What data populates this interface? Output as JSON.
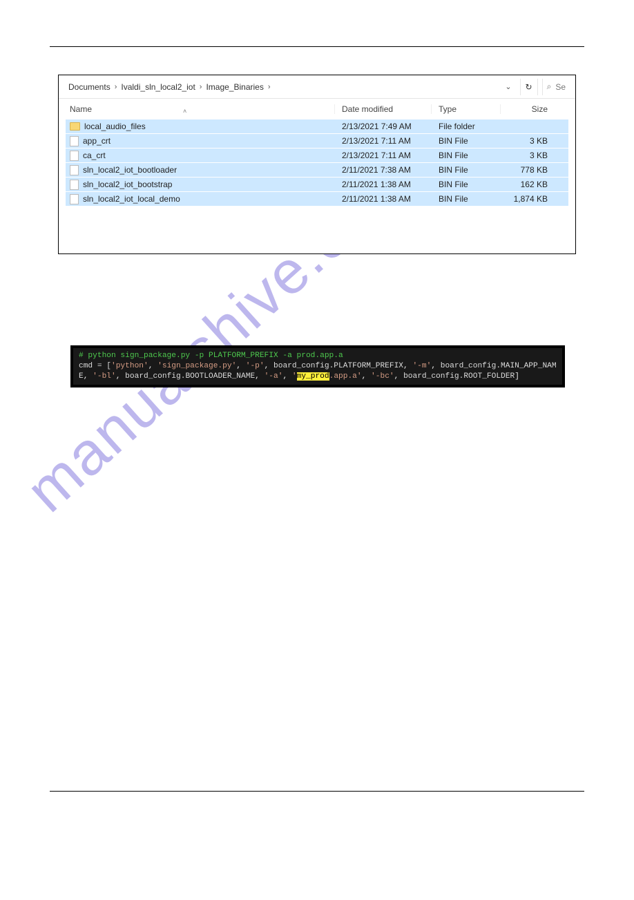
{
  "watermark": "manualshive.com",
  "explorer": {
    "breadcrumb": [
      "Documents",
      "Ivaldi_sln_local2_iot",
      "Image_Binaries"
    ],
    "search_placeholder": "Se",
    "columns": {
      "name": "Name",
      "date": "Date modified",
      "type": "Type",
      "size": "Size"
    },
    "rows": [
      {
        "kind": "folder",
        "name": "local_audio_files",
        "date": "2/13/2021 7:49 AM",
        "type": "File folder",
        "size": ""
      },
      {
        "kind": "file",
        "name": "app_crt",
        "date": "2/13/2021 7:11 AM",
        "type": "BIN File",
        "size": "3 KB"
      },
      {
        "kind": "file",
        "name": "ca_crt",
        "date": "2/13/2021 7:11 AM",
        "type": "BIN File",
        "size": "3 KB"
      },
      {
        "kind": "file",
        "name": "sln_local2_iot_bootloader",
        "date": "2/11/2021 7:38 AM",
        "type": "BIN File",
        "size": "778 KB"
      },
      {
        "kind": "file",
        "name": "sln_local2_iot_bootstrap",
        "date": "2/11/2021 1:38 AM",
        "type": "BIN File",
        "size": "162 KB"
      },
      {
        "kind": "file",
        "name": "sln_local2_iot_local_demo",
        "date": "2/11/2021 1:38 AM",
        "type": "BIN File",
        "size": "1,874 KB"
      }
    ]
  },
  "code": {
    "comment": "# python sign_package.py -p PLATFORM_PREFIX -a prod.app.a",
    "line2_pre": "cmd = [",
    "tokens": {
      "python": "'python'",
      "sign": "'sign_package.py'",
      "p": "'-p'",
      "platform": "board_config.PLATFORM_PREFIX",
      "m": "'-m'",
      "main": "board_config.MAIN_APP_NAME",
      "bl_flag": "'-bl'",
      "bootloader": "board_config.BOOTLOADER_NAME",
      "a": "'-a'",
      "hl_pre": "'",
      "hl": "my_prod",
      "hl_post": ".app.a'",
      "bc": "'-bc'",
      "root": "board_config.ROOT_FOLDER"
    }
  }
}
